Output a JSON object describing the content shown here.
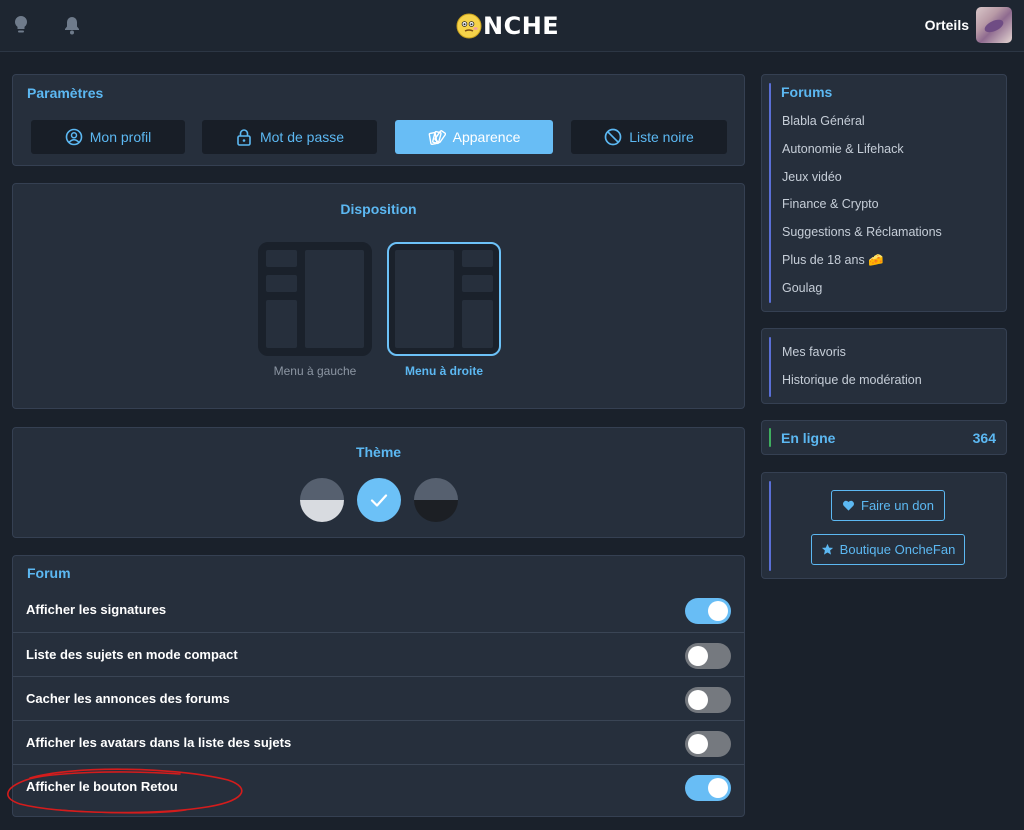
{
  "header": {
    "logo_text": "NCHE",
    "username": "Orteils"
  },
  "settings": {
    "title": "Paramètres",
    "buttons": [
      {
        "label": "Mon profil",
        "active": false
      },
      {
        "label": "Mot de passe",
        "active": false
      },
      {
        "label": "Apparence",
        "active": true
      },
      {
        "label": "Liste noire",
        "active": false
      }
    ]
  },
  "layout": {
    "title": "Disposition",
    "options": [
      {
        "label": "Menu à gauche",
        "selected": false
      },
      {
        "label": "Menu à droite",
        "selected": true
      }
    ]
  },
  "theme": {
    "title": "Thème",
    "options": [
      {
        "name": "light",
        "bottom_color": "#d8dbe0",
        "selected": false
      },
      {
        "name": "blue",
        "color": "#6cc1f7",
        "selected": true
      },
      {
        "name": "dark",
        "bottom_color": "#1c1f24",
        "selected": false
      }
    ]
  },
  "forum": {
    "title": "Forum",
    "rows": [
      {
        "label": "Afficher les signatures",
        "on": true
      },
      {
        "label": "Liste des sujets en mode compact",
        "on": false
      },
      {
        "label": "Cacher les annonces des forums",
        "on": false
      },
      {
        "label": "Afficher les avatars dans la liste des sujets",
        "on": false
      },
      {
        "label": "Afficher le bouton Retou",
        "on": true
      }
    ]
  },
  "sidebar": {
    "forums_title": "Forums",
    "forums": [
      "Blabla Général",
      "Autonomie & Lifehack",
      "Jeux vidéo",
      "Finance & Crypto",
      "Suggestions & Réclamations",
      "Plus de 18 ans 🧀",
      "Goulag"
    ],
    "links": [
      "Mes favoris",
      "Historique de modération"
    ],
    "online_label": "En ligne",
    "online_count": "364",
    "donate_label": "Faire un don",
    "shop_label": "Boutique OncheFan"
  },
  "colors": {
    "accent": "#5cb8f2",
    "background": "#1a212b",
    "panel": "#262f3c",
    "online_bar": "#3fae5f",
    "side_bar": "#5a6fd6",
    "annotation": "#d41c1c"
  }
}
